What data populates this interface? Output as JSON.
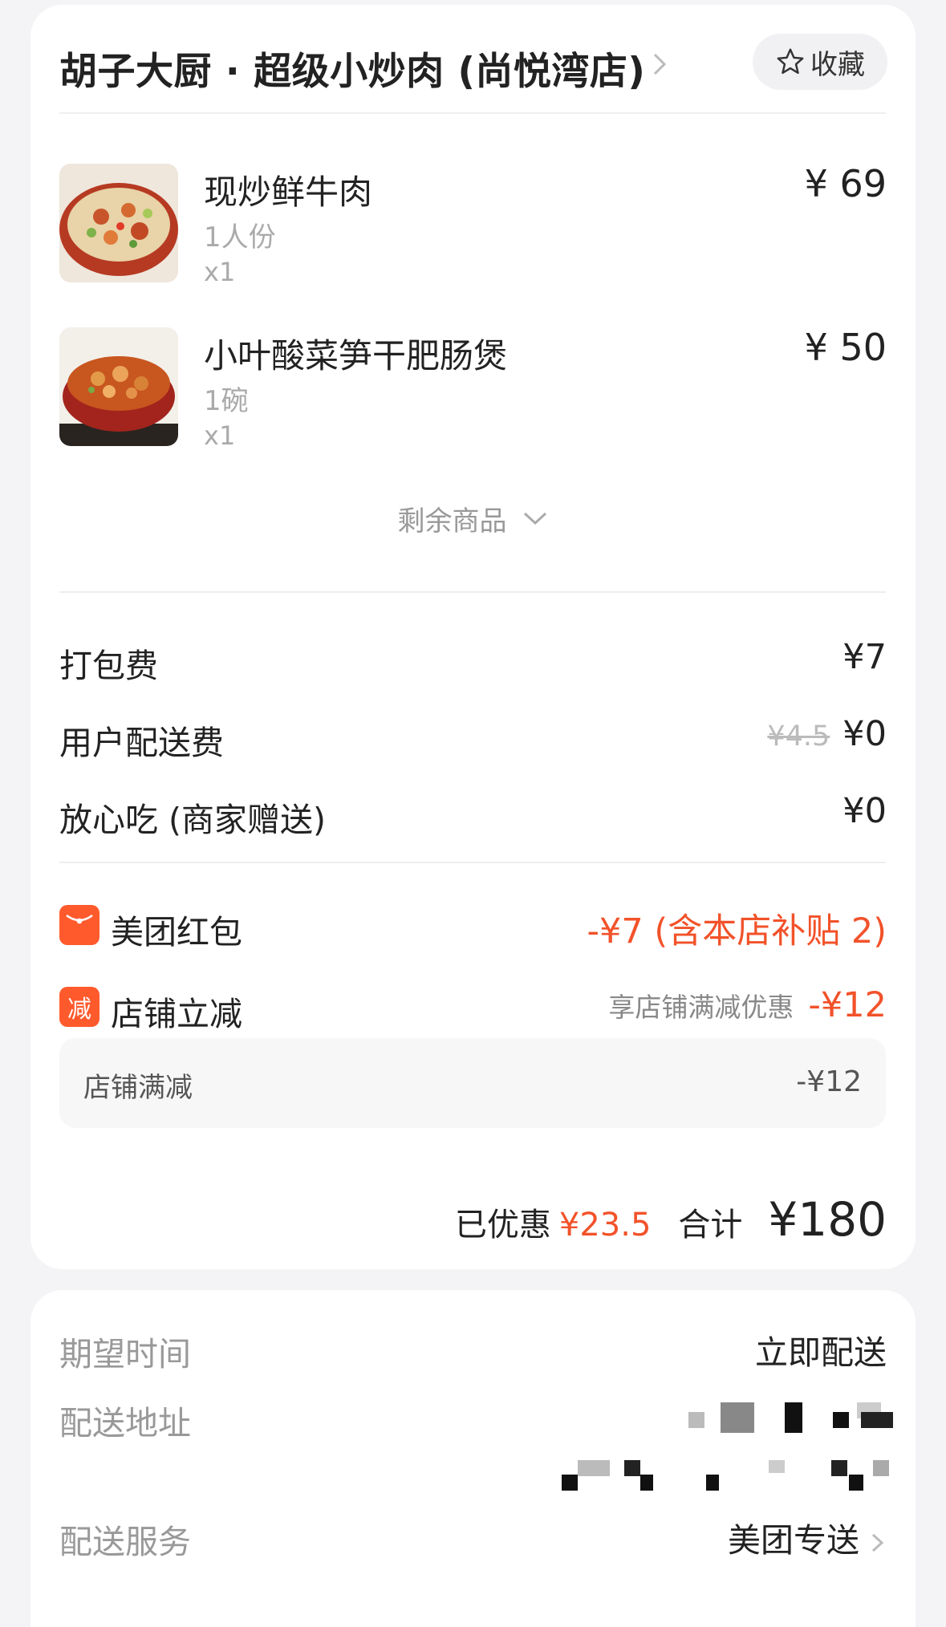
{
  "shop": {
    "name": "胡子大厨 · 超级小炒肉 (尚悦湾店)",
    "favorite_label": "收藏"
  },
  "items": [
    {
      "name": "现炒鲜牛肉",
      "spec": "1人份",
      "qty": "x1",
      "price": "¥ 69",
      "image_icon": "dish-beef-photo"
    },
    {
      "name": "小叶酸菜笋干肥肠煲",
      "spec": "1碗",
      "qty": "x1",
      "price": "¥ 50",
      "image_icon": "dish-intestine-pot-photo"
    }
  ],
  "more_items_label": "剩余商品",
  "fees": [
    {
      "label": "打包费",
      "value": "¥7"
    },
    {
      "label": "用户配送费",
      "original": "¥4.5",
      "value": "¥0"
    },
    {
      "label": "放心吃 (商家赠送)",
      "value": "¥0"
    }
  ],
  "promos": {
    "red_packet": {
      "label": "美团红包",
      "value": "-¥7 (含本店补贴 2)"
    },
    "shop_discount": {
      "badge": "减",
      "label": "店铺立减",
      "note": "享店铺满减优惠",
      "value": "-¥12"
    },
    "detail": {
      "label": "店铺满减",
      "value": "-¥12"
    }
  },
  "summary": {
    "saved_label": "已优惠",
    "saved_value": "¥23.5",
    "total_label": "合计",
    "total_value": "¥180"
  },
  "delivery": {
    "time_label": "期望时间",
    "time_value": "立即配送",
    "address_label": "配送地址",
    "service_label": "配送服务",
    "service_value": "美团专送"
  },
  "colors": {
    "accent_red": "#f2522a",
    "badge_orange": "#ff5a2c"
  }
}
